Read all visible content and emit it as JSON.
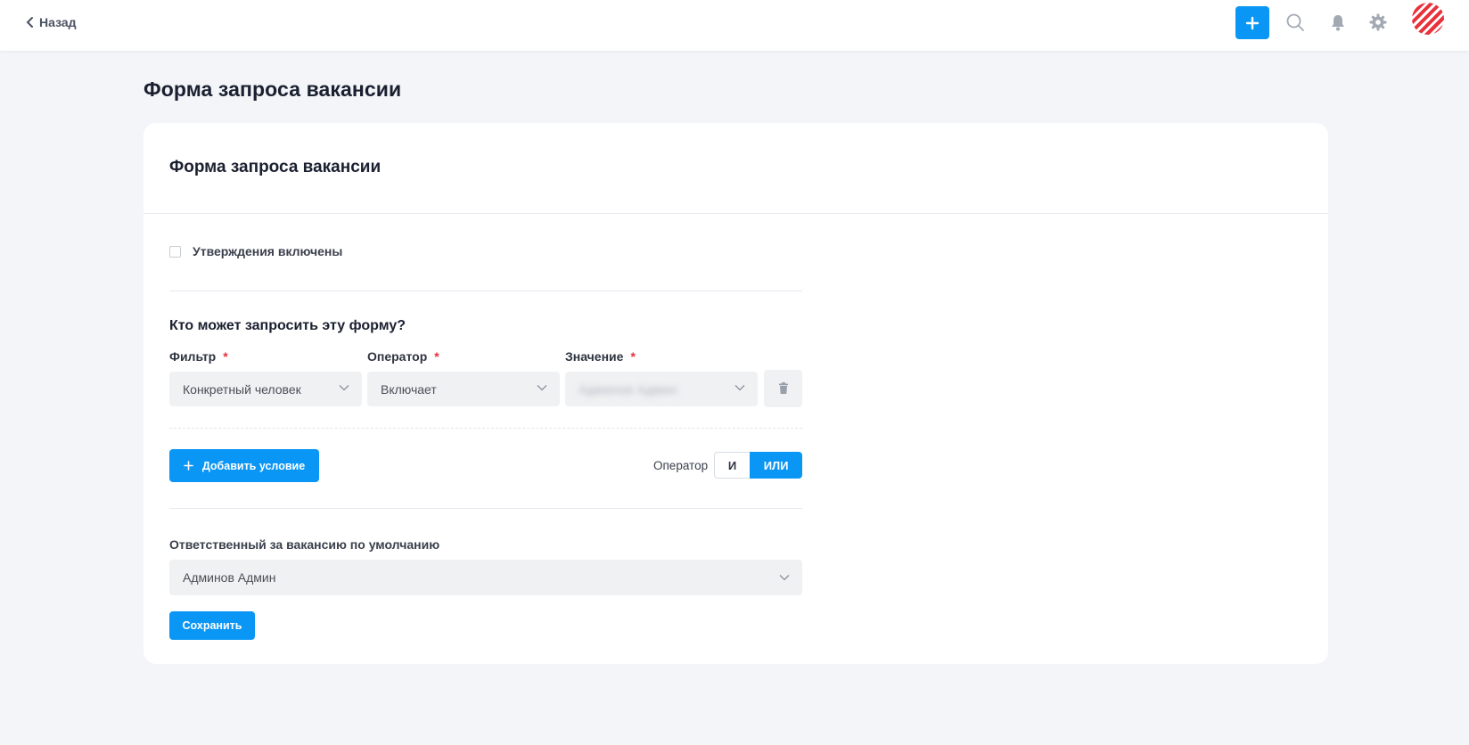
{
  "header": {
    "back_label": "Назад",
    "add_icon": "plus-icon",
    "search_icon": "search-icon",
    "bell_icon": "bell-icon",
    "gear_icon": "gear-icon",
    "accent_color": "#0a96f5"
  },
  "page": {
    "title": "Форма запроса вакансии"
  },
  "card": {
    "title": "Форма запроса вакансии",
    "approvals_label": "Утверждения включены",
    "approvals_checked": false,
    "who_title": "Кто может запросить эту форму?",
    "filter_label": "Фильтр",
    "operator_label": "Оператор",
    "value_label": "Значение",
    "required_mark": "*",
    "condition": {
      "filter_value": "Конкретный человек",
      "operator_value": "Включает",
      "value_value": "Админов Админ"
    },
    "add_condition_label": "Добавить условие",
    "logic_operator_label": "Оператор",
    "logic_and": "И",
    "logic_or": "ИЛИ",
    "logic_selected": "ИЛИ",
    "responsible_label": "Ответственный за вакансию по умолчанию",
    "responsible_value": "Админов Админ",
    "save_label": "Сохранить"
  }
}
